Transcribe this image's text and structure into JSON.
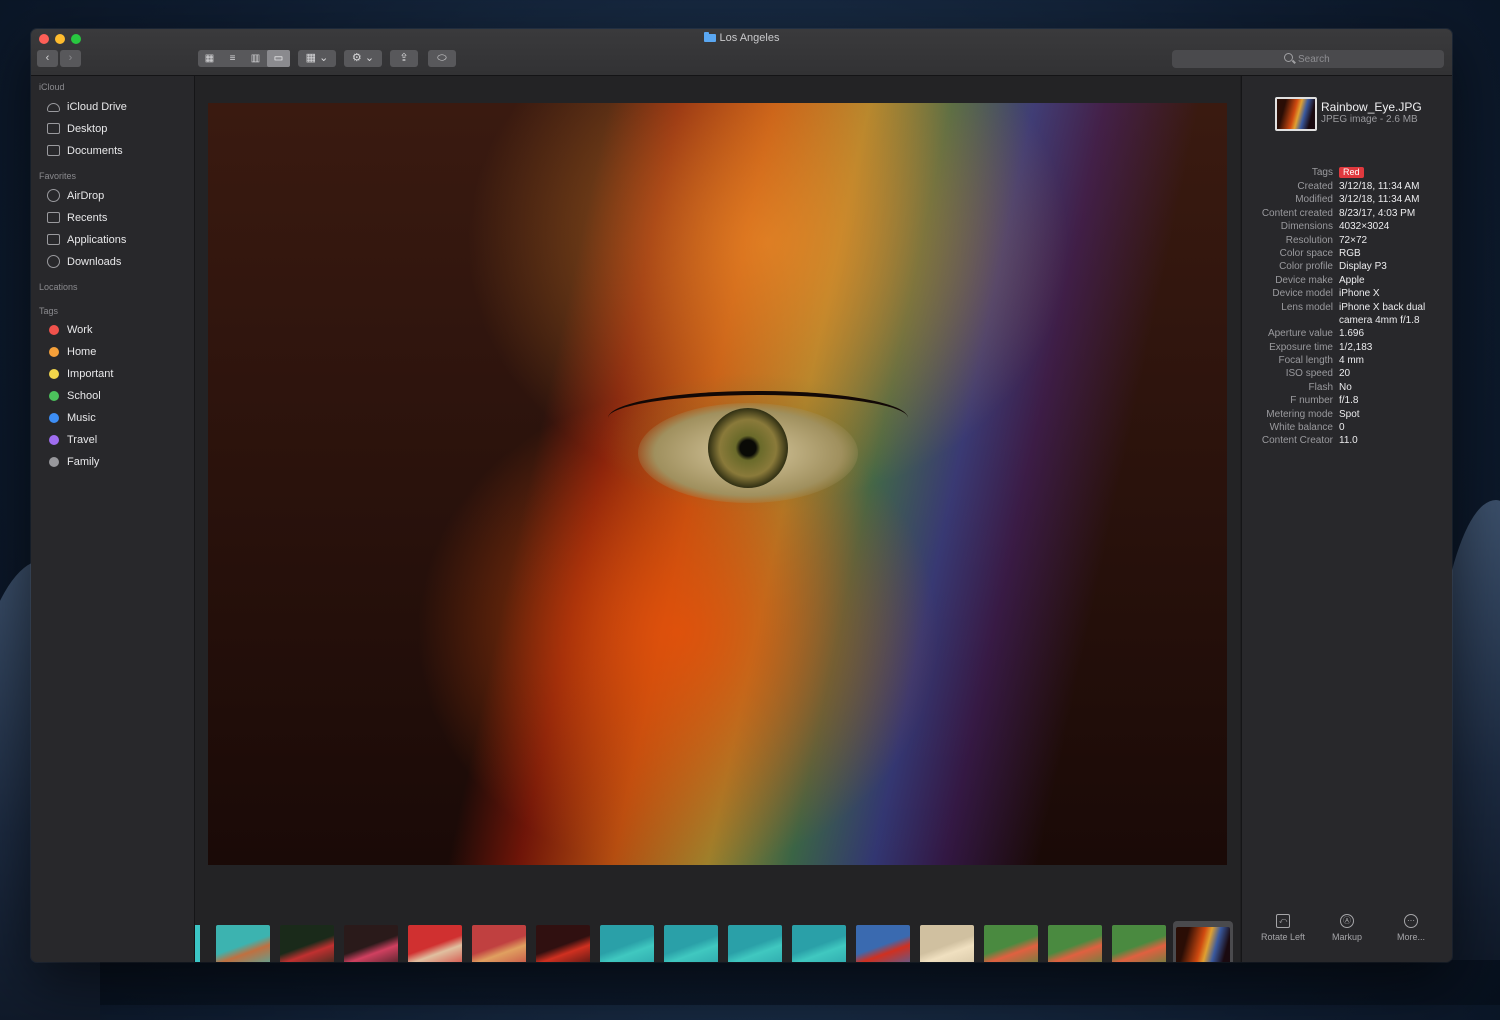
{
  "window": {
    "title": "Los Angeles"
  },
  "toolbar": {
    "back": "‹",
    "forward": "›",
    "view_icons": "▦",
    "view_list": "≡",
    "view_columns": "▥",
    "view_gallery": "▭",
    "group": "▦ ⌄",
    "action": "⚙ ⌄",
    "share": "⇪",
    "tag": "⬭",
    "search_placeholder": "Search"
  },
  "sidebar": {
    "icloud_header": "iCloud",
    "icloud": [
      "iCloud Drive",
      "Desktop",
      "Documents"
    ],
    "favorites_header": "Favorites",
    "favorites": [
      "AirDrop",
      "Recents",
      "Applications",
      "Downloads"
    ],
    "locations_header": "Locations",
    "tags_header": "Tags",
    "tags": [
      {
        "label": "Work",
        "color": "#f0524c"
      },
      {
        "label": "Home",
        "color": "#f5a03a"
      },
      {
        "label": "Important",
        "color": "#f2d64b"
      },
      {
        "label": "School",
        "color": "#4cc25c"
      },
      {
        "label": "Music",
        "color": "#3d8ef5"
      },
      {
        "label": "Travel",
        "color": "#9f6df0"
      },
      {
        "label": "Family",
        "color": "#98989c"
      }
    ]
  },
  "inspector": {
    "file_name": "Rainbow_Eye.JPG",
    "file_type": "JPEG image - 2.6 MB",
    "tag_label": "Tags",
    "tag_value": "Red",
    "metadata": [
      {
        "key": "Created",
        "value": "3/12/18, 11:34 AM"
      },
      {
        "key": "Modified",
        "value": "3/12/18, 11:34 AM"
      },
      {
        "key": "Content created",
        "value": "8/23/17, 4:03 PM"
      },
      {
        "key": "Dimensions",
        "value": "4032×3024"
      },
      {
        "key": "Resolution",
        "value": "72×72"
      },
      {
        "key": "Color space",
        "value": "RGB"
      },
      {
        "key": "Color profile",
        "value": "Display P3"
      },
      {
        "key": "Device make",
        "value": "Apple"
      },
      {
        "key": "Device model",
        "value": "iPhone X"
      },
      {
        "key": "Lens model",
        "value": "iPhone X back dual camera 4mm f/1.8"
      },
      {
        "key": "Aperture value",
        "value": "1.696"
      },
      {
        "key": "Exposure time",
        "value": "1/2,183"
      },
      {
        "key": "Focal length",
        "value": "4 mm"
      },
      {
        "key": "ISO speed",
        "value": "20"
      },
      {
        "key": "Flash",
        "value": "No"
      },
      {
        "key": "F number",
        "value": "f/1.8"
      },
      {
        "key": "Metering mode",
        "value": "Spot"
      },
      {
        "key": "White balance",
        "value": "0"
      },
      {
        "key": "Content Creator",
        "value": "11.0"
      }
    ],
    "actions": [
      {
        "label": "Rotate Left",
        "icon": "⤺"
      },
      {
        "label": "Markup",
        "icon": "Ⓐ"
      },
      {
        "label": "More...",
        "icon": "⋯"
      }
    ]
  },
  "filmstrip": {
    "thumbnails": [
      {
        "colors": [
          "#3cb3b0",
          "#c07040"
        ]
      },
      {
        "colors": [
          "#1a2a1a",
          "#c03030"
        ]
      },
      {
        "colors": [
          "#2a1a1a",
          "#d04060"
        ]
      },
      {
        "colors": [
          "#d03030",
          "#e0c0a0"
        ]
      },
      {
        "colors": [
          "#c04040",
          "#e0a060"
        ]
      },
      {
        "colors": [
          "#301010",
          "#d03020"
        ]
      },
      {
        "colors": [
          "#2aa0a8",
          "#40c8c0"
        ]
      },
      {
        "colors": [
          "#2aa0a8",
          "#40c8c0"
        ]
      },
      {
        "colors": [
          "#2aa0a8",
          "#40c8c0"
        ]
      },
      {
        "colors": [
          "#2aa0a8",
          "#40c8c0"
        ]
      },
      {
        "colors": [
          "#3a6ab0",
          "#d03020"
        ]
      },
      {
        "colors": [
          "#d0c0a0",
          "#f0e0c0"
        ]
      },
      {
        "colors": [
          "#4a8a40",
          "#e06040"
        ]
      },
      {
        "colors": [
          "#4a8a40",
          "#e06040"
        ]
      },
      {
        "colors": [
          "#4a8a40",
          "#e06040"
        ]
      }
    ]
  }
}
